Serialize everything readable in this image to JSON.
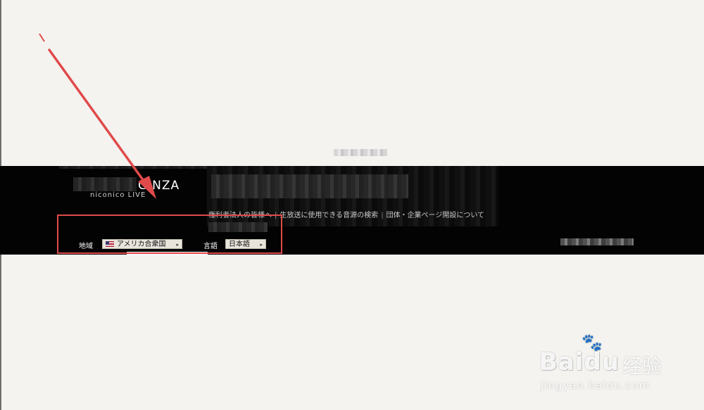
{
  "footer": {
    "logo_text": "GINZA",
    "logo_sub": "niconico LIVE",
    "links": [
      "権利者法人の皆様へ",
      "生放送に使用できる音源の検索",
      "団体・企業ページ開設について"
    ],
    "region_label": "地域",
    "region_value": "アメリカ合衆国",
    "language_label": "言語",
    "language_value": "日本語"
  },
  "colors": {
    "footer_bg": "#030303",
    "annotation_red": "#e04a4a",
    "page_bg": "#f4f3f0"
  },
  "watermark": {
    "brand": "Baidu",
    "brand_cn": "经验",
    "url": "jingyan.baidu.com"
  }
}
